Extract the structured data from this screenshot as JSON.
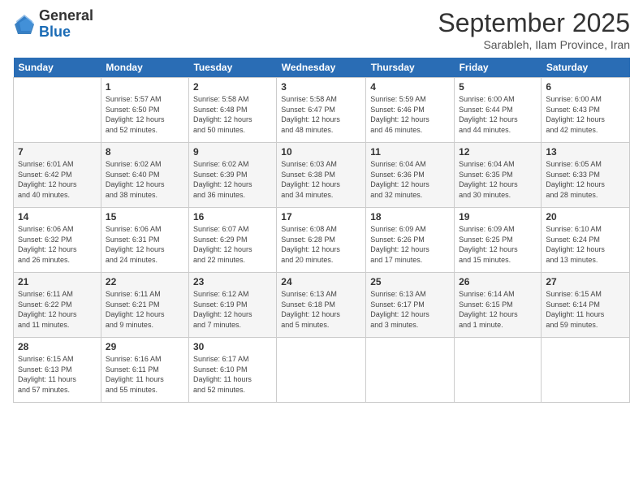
{
  "logo": {
    "general": "General",
    "blue": "Blue"
  },
  "header": {
    "title": "September 2025",
    "subtitle": "Sarableh, Ilam Province, Iran"
  },
  "days_of_week": [
    "Sunday",
    "Monday",
    "Tuesday",
    "Wednesday",
    "Thursday",
    "Friday",
    "Saturday"
  ],
  "weeks": [
    [
      {
        "day": "",
        "info": ""
      },
      {
        "day": "1",
        "info": "Sunrise: 5:57 AM\nSunset: 6:50 PM\nDaylight: 12 hours\nand 52 minutes."
      },
      {
        "day": "2",
        "info": "Sunrise: 5:58 AM\nSunset: 6:48 PM\nDaylight: 12 hours\nand 50 minutes."
      },
      {
        "day": "3",
        "info": "Sunrise: 5:58 AM\nSunset: 6:47 PM\nDaylight: 12 hours\nand 48 minutes."
      },
      {
        "day": "4",
        "info": "Sunrise: 5:59 AM\nSunset: 6:46 PM\nDaylight: 12 hours\nand 46 minutes."
      },
      {
        "day": "5",
        "info": "Sunrise: 6:00 AM\nSunset: 6:44 PM\nDaylight: 12 hours\nand 44 minutes."
      },
      {
        "day": "6",
        "info": "Sunrise: 6:00 AM\nSunset: 6:43 PM\nDaylight: 12 hours\nand 42 minutes."
      }
    ],
    [
      {
        "day": "7",
        "info": "Sunrise: 6:01 AM\nSunset: 6:42 PM\nDaylight: 12 hours\nand 40 minutes."
      },
      {
        "day": "8",
        "info": "Sunrise: 6:02 AM\nSunset: 6:40 PM\nDaylight: 12 hours\nand 38 minutes."
      },
      {
        "day": "9",
        "info": "Sunrise: 6:02 AM\nSunset: 6:39 PM\nDaylight: 12 hours\nand 36 minutes."
      },
      {
        "day": "10",
        "info": "Sunrise: 6:03 AM\nSunset: 6:38 PM\nDaylight: 12 hours\nand 34 minutes."
      },
      {
        "day": "11",
        "info": "Sunrise: 6:04 AM\nSunset: 6:36 PM\nDaylight: 12 hours\nand 32 minutes."
      },
      {
        "day": "12",
        "info": "Sunrise: 6:04 AM\nSunset: 6:35 PM\nDaylight: 12 hours\nand 30 minutes."
      },
      {
        "day": "13",
        "info": "Sunrise: 6:05 AM\nSunset: 6:33 PM\nDaylight: 12 hours\nand 28 minutes."
      }
    ],
    [
      {
        "day": "14",
        "info": "Sunrise: 6:06 AM\nSunset: 6:32 PM\nDaylight: 12 hours\nand 26 minutes."
      },
      {
        "day": "15",
        "info": "Sunrise: 6:06 AM\nSunset: 6:31 PM\nDaylight: 12 hours\nand 24 minutes."
      },
      {
        "day": "16",
        "info": "Sunrise: 6:07 AM\nSunset: 6:29 PM\nDaylight: 12 hours\nand 22 minutes."
      },
      {
        "day": "17",
        "info": "Sunrise: 6:08 AM\nSunset: 6:28 PM\nDaylight: 12 hours\nand 20 minutes."
      },
      {
        "day": "18",
        "info": "Sunrise: 6:09 AM\nSunset: 6:26 PM\nDaylight: 12 hours\nand 17 minutes."
      },
      {
        "day": "19",
        "info": "Sunrise: 6:09 AM\nSunset: 6:25 PM\nDaylight: 12 hours\nand 15 minutes."
      },
      {
        "day": "20",
        "info": "Sunrise: 6:10 AM\nSunset: 6:24 PM\nDaylight: 12 hours\nand 13 minutes."
      }
    ],
    [
      {
        "day": "21",
        "info": "Sunrise: 6:11 AM\nSunset: 6:22 PM\nDaylight: 12 hours\nand 11 minutes."
      },
      {
        "day": "22",
        "info": "Sunrise: 6:11 AM\nSunset: 6:21 PM\nDaylight: 12 hours\nand 9 minutes."
      },
      {
        "day": "23",
        "info": "Sunrise: 6:12 AM\nSunset: 6:19 PM\nDaylight: 12 hours\nand 7 minutes."
      },
      {
        "day": "24",
        "info": "Sunrise: 6:13 AM\nSunset: 6:18 PM\nDaylight: 12 hours\nand 5 minutes."
      },
      {
        "day": "25",
        "info": "Sunrise: 6:13 AM\nSunset: 6:17 PM\nDaylight: 12 hours\nand 3 minutes."
      },
      {
        "day": "26",
        "info": "Sunrise: 6:14 AM\nSunset: 6:15 PM\nDaylight: 12 hours\nand 1 minute."
      },
      {
        "day": "27",
        "info": "Sunrise: 6:15 AM\nSunset: 6:14 PM\nDaylight: 11 hours\nand 59 minutes."
      }
    ],
    [
      {
        "day": "28",
        "info": "Sunrise: 6:15 AM\nSunset: 6:13 PM\nDaylight: 11 hours\nand 57 minutes."
      },
      {
        "day": "29",
        "info": "Sunrise: 6:16 AM\nSunset: 6:11 PM\nDaylight: 11 hours\nand 55 minutes."
      },
      {
        "day": "30",
        "info": "Sunrise: 6:17 AM\nSunset: 6:10 PM\nDaylight: 11 hours\nand 52 minutes."
      },
      {
        "day": "",
        "info": ""
      },
      {
        "day": "",
        "info": ""
      },
      {
        "day": "",
        "info": ""
      },
      {
        "day": "",
        "info": ""
      }
    ]
  ]
}
